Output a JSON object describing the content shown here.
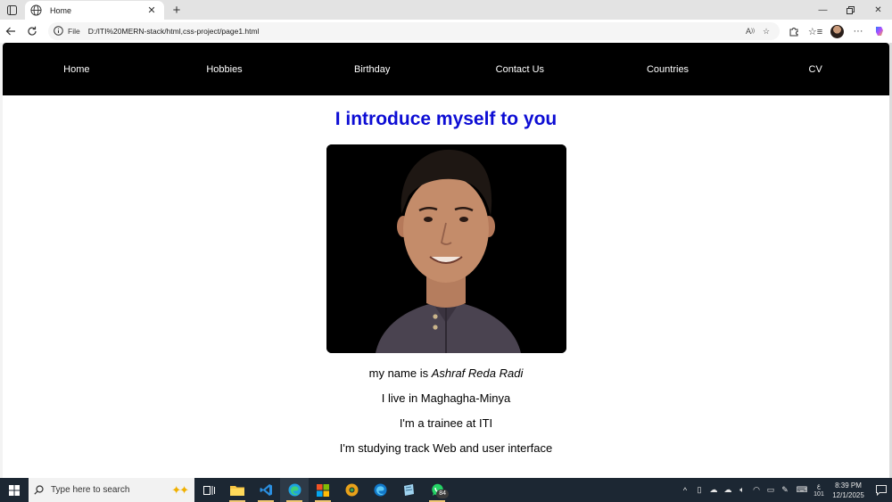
{
  "browser": {
    "tab_title": "Home",
    "scheme_label": "File",
    "url": "D:/ITI%20MERN-stack/html,css-project/page1.html"
  },
  "site": {
    "nav": [
      "Home",
      "Hobbies",
      "Birthday",
      "Contact Us",
      "Countries",
      "CV"
    ],
    "heading": "I introduce myself to you",
    "name_prefix": "my name is ",
    "name": "Ashraf Reda Radi",
    "lines": [
      "I live in Maghagha-Minya",
      "I'm a trainee at ITI",
      "I'm studying track Web and user interface"
    ],
    "colors": {
      "heading": "#0d0dd4",
      "nav_bg": "#000000",
      "nav_text": "#ffffff"
    }
  },
  "taskbar": {
    "search_placeholder": "Type here to search",
    "whatsapp_badge": "84",
    "lang_top": "ع",
    "lang_bottom": "101",
    "time": "8:39 PM",
    "date": "12/1/2025"
  }
}
